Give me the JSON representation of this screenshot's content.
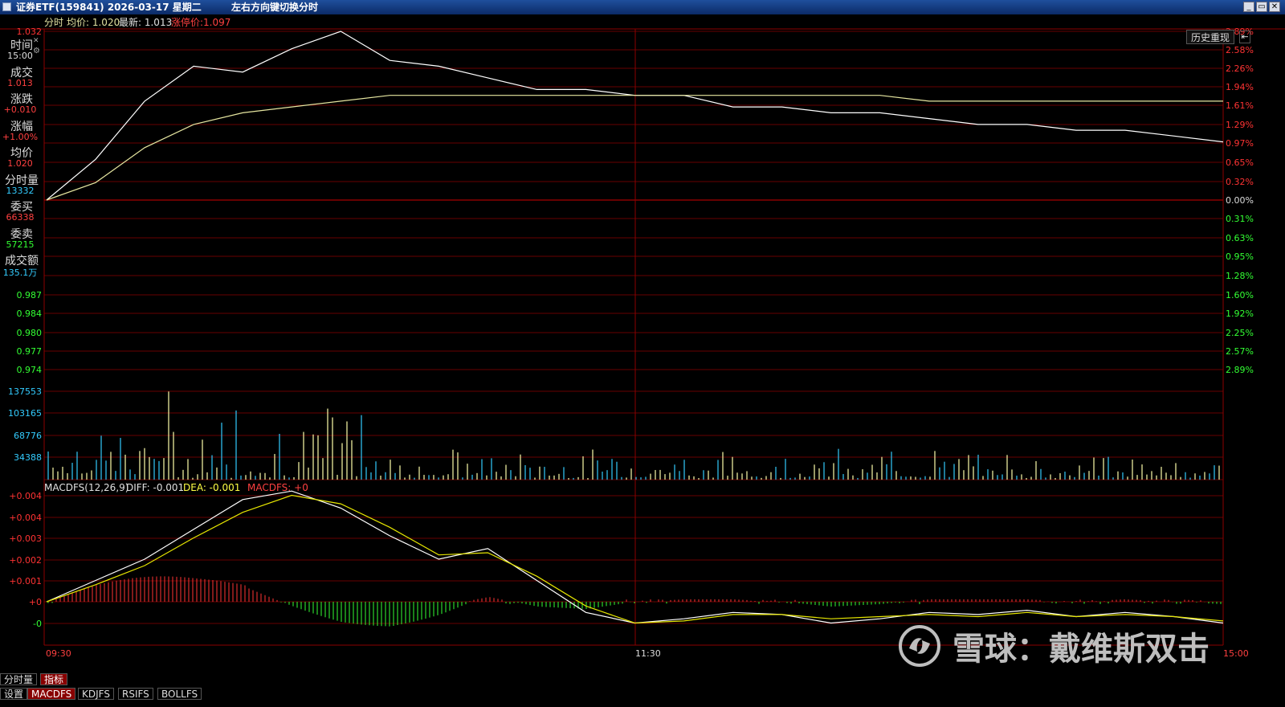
{
  "window": {
    "title": "证券ETF(159841) 2026-03-17 星期二",
    "hint": "左右方向键切换分时",
    "buttons": [
      "_",
      "▭",
      "✕"
    ]
  },
  "header_info": {
    "label": "分时",
    "avg_label": "均价: 1.020",
    "latest_label": "最新: 1.013",
    "limit_label": "涨停价:1.097"
  },
  "history_button": "历史重现",
  "history_arrow": "⇤",
  "side_panel": [
    {
      "label": "时间",
      "value": "15:00",
      "color": "#dddddd"
    },
    {
      "label": "成交",
      "value": "1.013",
      "color": "#ff4040"
    },
    {
      "label": "涨跌",
      "value": "+0.010",
      "color": "#ff4040"
    },
    {
      "label": "涨幅",
      "value": "+1.00%",
      "color": "#ff4040"
    },
    {
      "label": "均价",
      "value": "1.020",
      "color": "#ff4040"
    },
    {
      "label": "分时量",
      "value": "13332",
      "color": "#33ccff"
    },
    {
      "label": "委买",
      "value": "66338",
      "color": "#ff4040"
    },
    {
      "label": "委卖",
      "value": "57215",
      "color": "#33ff33"
    },
    {
      "label": "成交额",
      "value": "135.1万",
      "color": "#33ccff"
    }
  ],
  "price_axis_left": [
    "1.032",
    "0.987",
    "0.984",
    "0.980",
    "0.977",
    "0.974"
  ],
  "price_axis_right": [
    "2.89%",
    "2.58%",
    "2.26%",
    "1.94%",
    "1.61%",
    "1.29%",
    "0.97%",
    "0.65%",
    "0.32%",
    "0.00%",
    "0.31%",
    "0.63%",
    "0.95%",
    "1.28%",
    "1.60%",
    "1.92%",
    "2.25%",
    "2.57%",
    "2.89%"
  ],
  "volume_axis": [
    "137553",
    "103165",
    "68776",
    "34388"
  ],
  "macd": {
    "title": "MACDFS(12,26,9)",
    "diff": "DIFF: -0.001",
    "dea": "DEA: -0.001",
    "macdfs": "MACDFS: +0",
    "axis": [
      "+0.004",
      "+0.004",
      "+0.003",
      "+0.002",
      "+0.001",
      "+0",
      "-0"
    ]
  },
  "time_axis": [
    "09:30",
    "11:30",
    "15:00"
  ],
  "indicator_tabs": [
    "设置",
    "MACDFS",
    "KDJFS",
    "RSIFS",
    "BOLLFS"
  ],
  "bottom_tabs": [
    "分时量",
    "指标"
  ],
  "watermark": "雪球：戴维斯双击",
  "colors": {
    "grid": "#8b0000",
    "price_line": "#ffffff",
    "avg_line": "#e6e6a0",
    "up": "#ff3333",
    "down": "#33ff33",
    "volume_up": "#ffffaa",
    "volume_down": "#33ccff"
  },
  "chart_data": [
    {
      "type": "line",
      "title": "分时",
      "x": [
        "09:30",
        "11:30",
        "15:00"
      ],
      "series": [
        {
          "name": "价格",
          "values": [
            1.003,
            1.01,
            1.02,
            1.026,
            1.025,
            1.029,
            1.032,
            1.027,
            1.026,
            1.024,
            1.022,
            1.022,
            1.021,
            1.021,
            1.019,
            1.019,
            1.018,
            1.018,
            1.017,
            1.016,
            1.016,
            1.015,
            1.015,
            1.014,
            1.013
          ]
        },
        {
          "name": "均价",
          "values": [
            1.003,
            1.006,
            1.012,
            1.016,
            1.018,
            1.019,
            1.02,
            1.021,
            1.021,
            1.021,
            1.021,
            1.021,
            1.021,
            1.021,
            1.021,
            1.021,
            1.021,
            1.021,
            1.02,
            1.02,
            1.02,
            1.02,
            1.02,
            1.02,
            1.02
          ]
        }
      ],
      "ylim": [
        0.974,
        1.032
      ]
    },
    {
      "type": "bar",
      "title": "分时量",
      "ylim": [
        0,
        137553
      ]
    },
    {
      "type": "line",
      "title": "MACDFS(12,26,9)",
      "series": [
        {
          "name": "DIFF",
          "values": [
            0.0,
            0.001,
            0.002,
            0.0034,
            0.0048,
            0.0052,
            0.0044,
            0.0031,
            0.002,
            0.0025,
            0.001,
            -0.0005,
            -0.001,
            -0.0008,
            -0.0005,
            -0.0006,
            -0.001,
            -0.0008,
            -0.0005,
            -0.0006,
            -0.0004,
            -0.0007,
            -0.0005,
            -0.0007,
            -0.001
          ]
        },
        {
          "name": "DEA",
          "values": [
            0.0,
            0.0008,
            0.0017,
            0.003,
            0.0042,
            0.005,
            0.0046,
            0.0035,
            0.0022,
            0.0023,
            0.0012,
            -0.0002,
            -0.001,
            -0.0009,
            -0.0006,
            -0.0006,
            -0.0008,
            -0.0007,
            -0.0006,
            -0.0007,
            -0.0005,
            -0.0007,
            -0.0006,
            -0.0007,
            -0.0009
          ]
        }
      ]
    }
  ]
}
